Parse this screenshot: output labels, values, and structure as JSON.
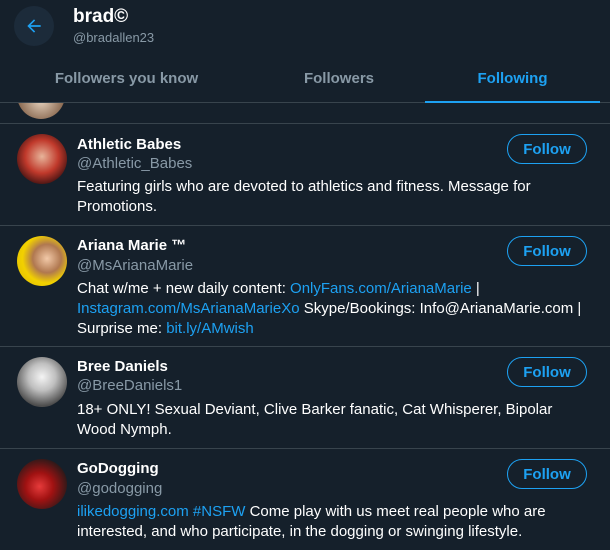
{
  "header": {
    "title": "brad©",
    "handle": "@bradallen23"
  },
  "tabs": [
    {
      "label": "Followers you know"
    },
    {
      "label": "Followers"
    },
    {
      "label": "Following"
    }
  ],
  "users": [
    {
      "name": "Athletic Babes",
      "handle": "@Athletic_Babes",
      "bio": "Featuring girls who are devoted to athletics and fitness. Message for Promotions.",
      "follow_label": "Follow"
    },
    {
      "name": "Ariana Marie ™",
      "handle": "@MsArianaMarie",
      "bio_parts": {
        "p1": "Chat w/me + new daily content: ",
        "link1": "OnlyFans.com/ArianaMarie",
        "p2": " |",
        "link2": "Instagram.com/MsArianaMarieXo",
        "p3": " Skype/Bookings: Info@ArianaMarie.com |",
        "p4": "Surprise me: ",
        "link3": "bit.ly/AMwish"
      },
      "follow_label": "Follow"
    },
    {
      "name": "Bree Daniels",
      "handle": "@BreeDaniels1",
      "bio": "18+ ONLY! Sexual Deviant, Clive Barker fanatic, Cat Whisperer, Bipolar Wood Nymph.",
      "follow_label": "Follow"
    },
    {
      "name": "GoDogging",
      "handle": "@godogging",
      "bio_parts": {
        "link1": "ilikedogging.com",
        "link2": "#NSFW",
        "p1": " Come play with us meet real people who are interested, and who participate, in the dogging or swinging lifestyle."
      },
      "follow_label": "Follow"
    }
  ],
  "colors": {
    "background": "#15202b",
    "accent": "#1da1f2",
    "secondary_text": "#8899a6",
    "divider": "#38444d"
  }
}
